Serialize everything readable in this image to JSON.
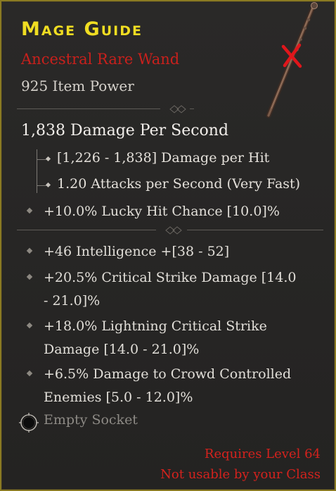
{
  "item": {
    "title": "Mage Guide",
    "subtype": "Ancestral Rare Wand",
    "item_power": "925 Item Power",
    "dps": "1,838 Damage Per Second",
    "damage_per_hit": "[1,226 - 1,838] Damage per Hit",
    "attacks_per_second": "1.20 Attacks per Second (Very Fast)",
    "implicit": "+10.0% Lucky Hit Chance [10.0]%",
    "affixes": [
      {
        "line1": "+46 Intelligence +[38 - 52]",
        "line2": ""
      },
      {
        "line1": "+20.5% Critical Strike Damage [14.0",
        "line2": "- 21.0]%"
      },
      {
        "line1": "+18.0% Lightning Critical Strike",
        "line2": "Damage [14.0 - 21.0]%"
      },
      {
        "line1": "+6.5% Damage to Crowd Controlled",
        "line2": "Enemies [5.0 - 12.0]%"
      }
    ],
    "socket": "Empty Socket",
    "requirements": {
      "level": "Requires Level 64",
      "class": "Not usable by your Class"
    }
  },
  "icons": {
    "wand": "wand-icon",
    "not-usable": "red-x-icon",
    "socket": "empty-socket-icon"
  },
  "colors": {
    "title": "#f0dd22",
    "rare_text": "#c8201c",
    "requirement_text": "#d4221d",
    "border": "#8a7a22"
  }
}
